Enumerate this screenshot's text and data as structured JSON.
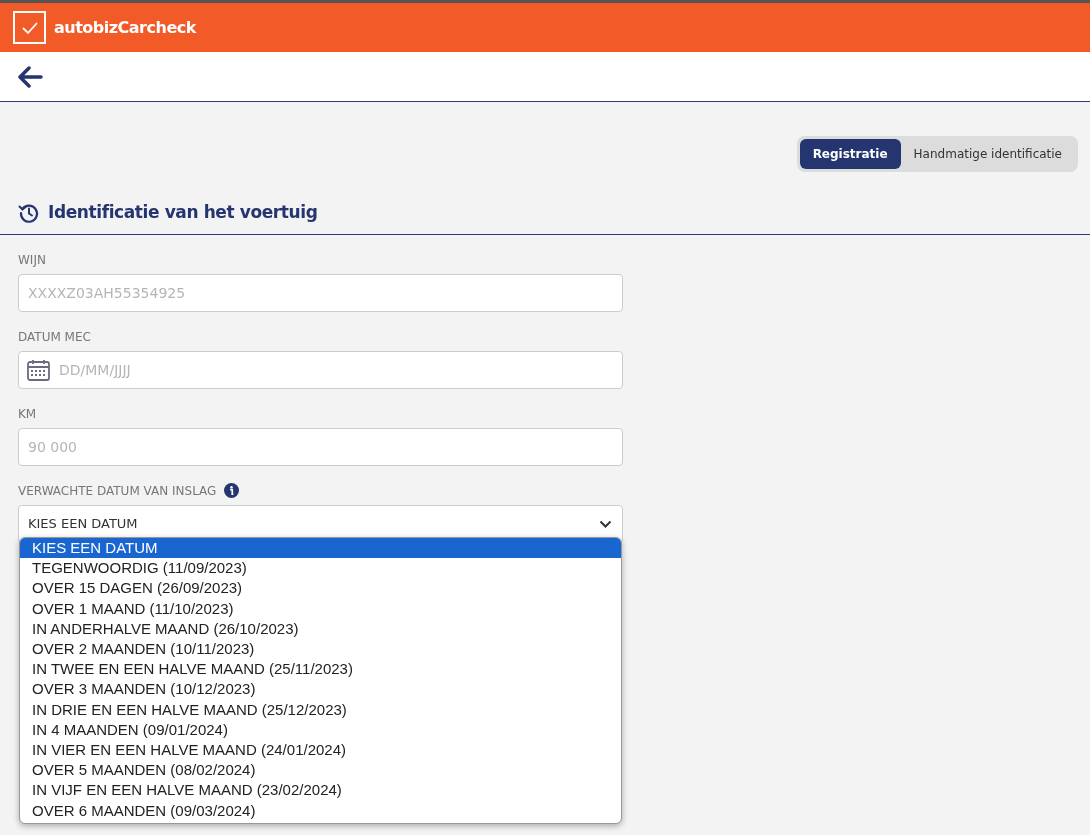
{
  "app": {
    "title": "autobizCarcheck"
  },
  "mode_tabs": [
    {
      "label": "Registratie",
      "selected": true
    },
    {
      "label": "Handmatige identificatie",
      "selected": false
    }
  ],
  "section": {
    "title": "Identificatie van het voertuig"
  },
  "fields": [
    {
      "kind": "text",
      "label": "WIJN",
      "placeholder": "XXXXZ03AH55354925"
    },
    {
      "kind": "date",
      "label": "DATUM MEC",
      "placeholder": "DD/MM/JJJJ"
    },
    {
      "kind": "text",
      "label": "KM",
      "placeholder": "90 000"
    },
    {
      "kind": "select",
      "label": "VERWACHTE DATUM VAN INSLAG",
      "info": true,
      "value": "KIES EEN DATUM"
    }
  ],
  "dropdown": {
    "options": [
      {
        "label": "KIES EEN DATUM",
        "selected": true
      },
      {
        "label": "TEGENWOORDIG (11/09/2023)",
        "selected": false
      },
      {
        "label": "OVER 15 DAGEN (26/09/2023)",
        "selected": false
      },
      {
        "label": "OVER 1 MAAND (11/10/2023)",
        "selected": false
      },
      {
        "label": "IN ANDERHALVE MAAND (26/10/2023)",
        "selected": false
      },
      {
        "label": "OVER 2 MAANDEN (10/11/2023)",
        "selected": false
      },
      {
        "label": "IN TWEE EN EEN HALVE MAAND (25/11/2023)",
        "selected": false
      },
      {
        "label": "OVER 3 MAANDEN (10/12/2023)",
        "selected": false
      },
      {
        "label": "IN DRIE EN EEN HALVE MAAND (25/12/2023)",
        "selected": false
      },
      {
        "label": "IN 4 MAANDEN (09/01/2024)",
        "selected": false
      },
      {
        "label": "IN VIER EN EEN HALVE MAAND (24/01/2024)",
        "selected": false
      },
      {
        "label": "OVER 5 MAANDEN (08/02/2024)",
        "selected": false
      },
      {
        "label": "IN VIJF EN EEN HALVE MAAND (23/02/2024)",
        "selected": false
      },
      {
        "label": "OVER 6 MAANDEN (09/03/2024)",
        "selected": false
      }
    ]
  }
}
